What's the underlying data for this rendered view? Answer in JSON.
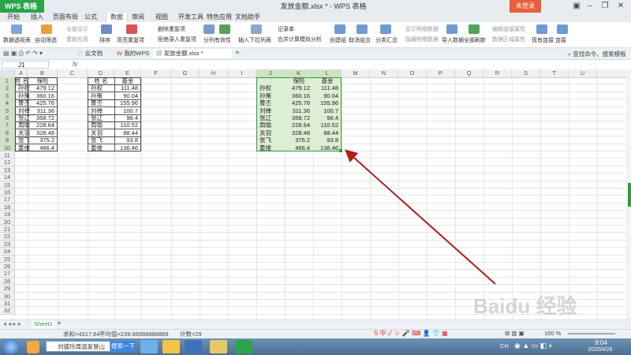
{
  "app": {
    "logo": "WPS 表格",
    "doc_title": "发放金额.xlsx * - WPS 表格",
    "login": "未登录"
  },
  "menu": [
    "开始",
    "插入",
    "页面布局",
    "公式",
    "数据",
    "审阅",
    "视图",
    "开发工具",
    "特色应用",
    "文档助手"
  ],
  "menu_active": "数据",
  "ribbon": {
    "pivot": "数据透视表",
    "autofilter": "自动筛选",
    "showall": "全部显示",
    "reapply": "重新应用",
    "sort": "排序",
    "highlight_dup": "高亮重复项",
    "remove_dup": "删除重复项",
    "reject_dup": "拒绝录入重复项",
    "split": "分列",
    "validity": "有效性",
    "dropdown": "插入下拉列表",
    "record": "记录单",
    "merge": "合并计算",
    "simulate": "模拟分析",
    "group": "创建组",
    "ungroup": "取消组合",
    "subtotal": "分类汇总",
    "show_detail": "显示明细数据",
    "hide_detail": "隐藏明细数据",
    "import": "导入数据",
    "refresh_all": "全部刷新",
    "edit_link": "编辑连接属性",
    "data_area": "数据区域属性",
    "existing_conn": "现有连接",
    "connect": "连接"
  },
  "tabs": {
    "cloud": "云文档",
    "mywps": "我的WPS",
    "file": "发放金额.xlsx *",
    "search": "查找命令、搜索模板"
  },
  "formula": {
    "namebox": "J1",
    "fx": "fx",
    "value": ""
  },
  "columns": [
    "A",
    "B",
    "C",
    "D",
    "E",
    "F",
    "G",
    "H",
    "I",
    "J",
    "K",
    "L",
    "M",
    "N",
    "O",
    "P",
    "Q",
    "R",
    "S",
    "T",
    "U"
  ],
  "rows": [
    "1",
    "2",
    "3",
    "4",
    "5",
    "6",
    "7",
    "8",
    "9",
    "10",
    "11",
    "12",
    "13",
    "14",
    "15",
    "16",
    "17",
    "18",
    "19",
    "20",
    "21",
    "22",
    "23",
    "24",
    "25",
    "26",
    "27",
    "28",
    "29",
    "30",
    "31",
    "32"
  ],
  "table1": {
    "headers": [
      "姓 名",
      "保险"
    ],
    "rows": [
      [
        "孙权",
        "479.12"
      ],
      [
        "孙策",
        "360.16"
      ],
      [
        "曹丕",
        "425.76"
      ],
      [
        "刘禅",
        "311.36"
      ],
      [
        "张辽",
        "358.72"
      ],
      [
        "周瑜",
        "228.64"
      ],
      [
        "关羽",
        "328.48"
      ],
      [
        "张飞",
        "375.2"
      ],
      [
        "姜维",
        "466.4"
      ]
    ]
  },
  "table2": {
    "headers": [
      "姓 名",
      "基金"
    ],
    "rows": [
      [
        "孙权",
        "111.48"
      ],
      [
        "孙策",
        "90.04"
      ],
      [
        "曹丕",
        "155.96"
      ],
      [
        "刘禅",
        "100.7"
      ],
      [
        "张辽",
        "96.4"
      ],
      [
        "周瑜",
        "110.52"
      ],
      [
        "关羽",
        "88.44"
      ],
      [
        "张飞",
        "93.8"
      ],
      [
        "姜维",
        "136.46"
      ]
    ]
  },
  "table3": {
    "headers": [
      "",
      "保险",
      "基金"
    ],
    "rows": [
      [
        "孙权",
        "479.12",
        "111.48"
      ],
      [
        "孙策",
        "360.16",
        "90.04"
      ],
      [
        "曹丕",
        "425.76",
        "155.96"
      ],
      [
        "刘禅",
        "311.36",
        "100.7"
      ],
      [
        "张辽",
        "358.72",
        "96.4"
      ],
      [
        "周瑜",
        "228.64",
        "110.52"
      ],
      [
        "关羽",
        "328.48",
        "88.44"
      ],
      [
        "张飞",
        "375.2",
        "93.8"
      ],
      [
        "姜维",
        "466.4",
        "136.46"
      ]
    ]
  },
  "sheet_tab": "Sheet1",
  "status": {
    "sum": "求和=4317.64",
    "avg": "平均值=239.86888888889",
    "count": "计数=29",
    "zoom": "100 %"
  },
  "taskbar": {
    "ie_text": "刘德玲周润发登山",
    "search_btn": "搜索一下",
    "time": "9:04",
    "date": "2020/4/26",
    "lang": "CH"
  },
  "watermark": "Baidu 经验 jingyan.baidu.com",
  "colors": {
    "wps_green": "#2aa34a",
    "selection_fill": "#dceed3",
    "selection_border": "#2e9b3a",
    "arrow": "#b01c1c"
  }
}
